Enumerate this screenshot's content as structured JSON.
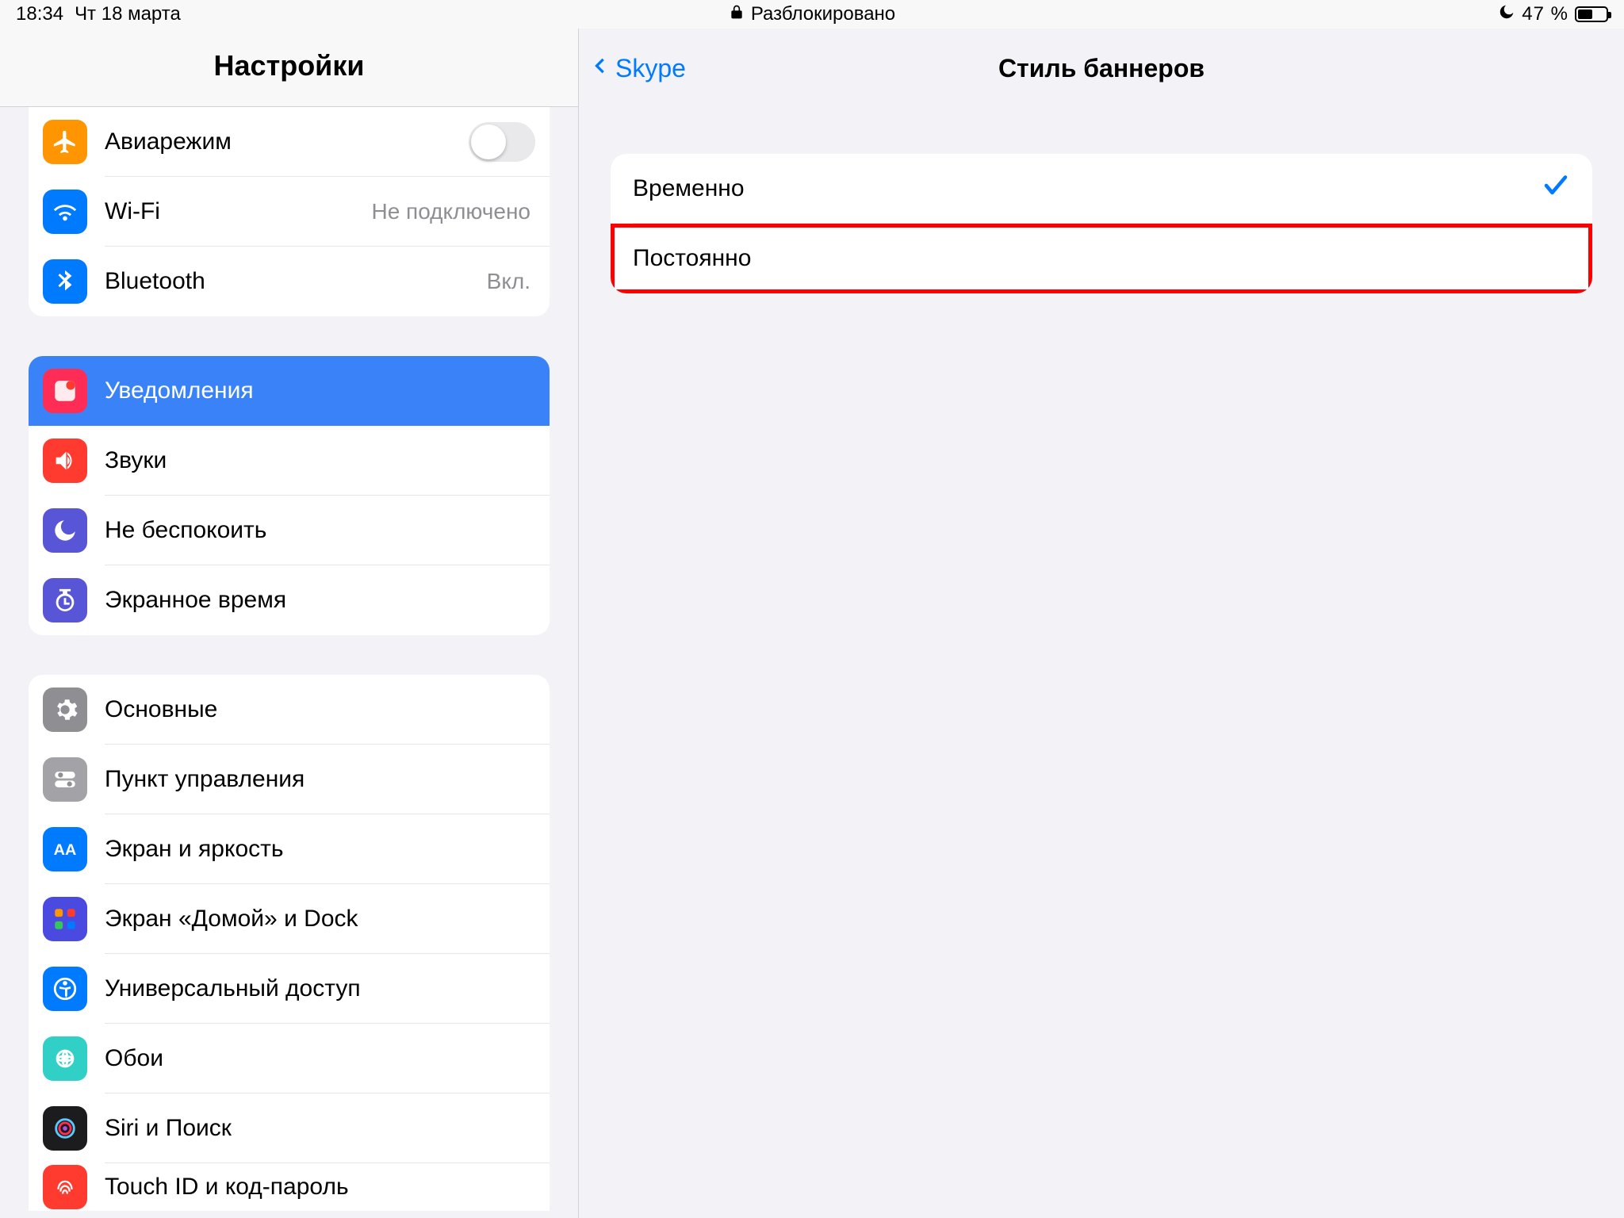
{
  "statusbar": {
    "time": "18:34",
    "date": "Чт 18 марта",
    "unlocked": "Разблокировано",
    "battery_text": "47 %"
  },
  "left": {
    "title": "Настройки",
    "group1": {
      "airplane": "Авиарежим",
      "wifi": "Wi-Fi",
      "wifi_detail": "Не подключено",
      "bluetooth": "Bluetooth",
      "bluetooth_detail": "Вкл."
    },
    "group2": {
      "notifications": "Уведомления",
      "sounds": "Звуки",
      "dnd": "Не беспокоить",
      "screentime": "Экранное время"
    },
    "group3": {
      "general": "Основные",
      "control": "Пункт управления",
      "display": "Экран и яркость",
      "home": "Экран «Домой» и Dock",
      "accessibility": "Универсальный доступ",
      "wallpaper": "Обои",
      "siri": "Siri и Поиск",
      "touchid": "Touch ID и код-пароль"
    }
  },
  "right": {
    "back": "Skype",
    "title": "Стиль баннеров",
    "option_temporary": "Временно",
    "option_persistent": "Постоянно"
  }
}
